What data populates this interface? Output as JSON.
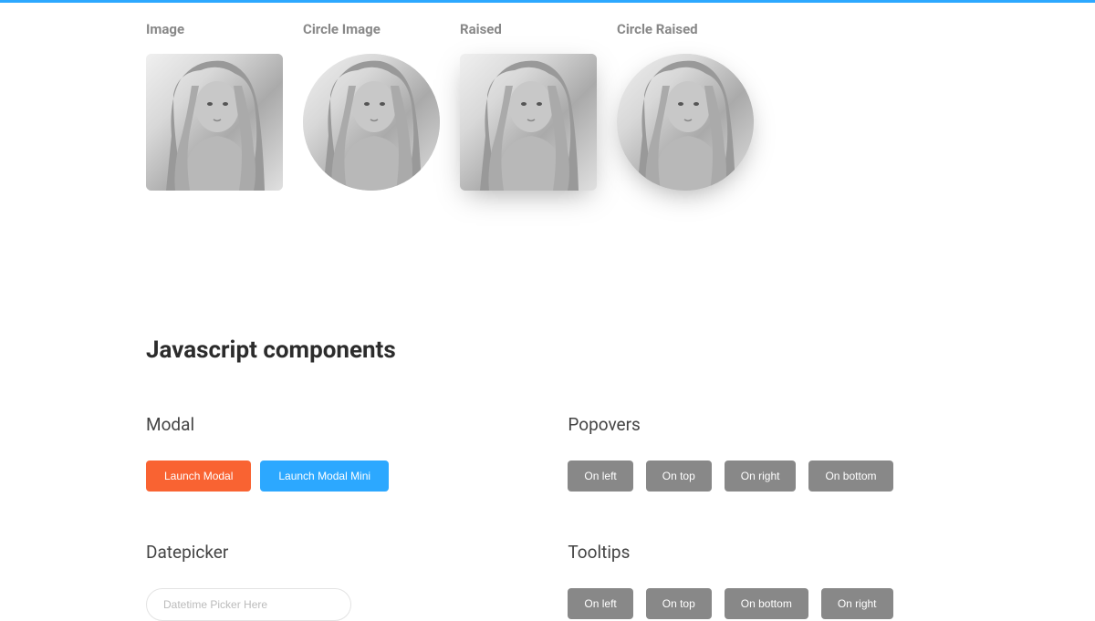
{
  "images": {
    "labels": [
      "Image",
      "Circle Image",
      "Raised",
      "Circle Raised"
    ]
  },
  "section_title": "Javascript components",
  "modal": {
    "title": "Modal",
    "buttons": {
      "launch": "Launch Modal",
      "launch_mini": "Launch Modal Mini"
    }
  },
  "popovers": {
    "title": "Popovers",
    "buttons": [
      "On left",
      "On top",
      "On right",
      "On bottom"
    ]
  },
  "datepicker": {
    "title": "Datepicker",
    "placeholder": "Datetime Picker Here"
  },
  "tooltips": {
    "title": "Tooltips",
    "buttons": [
      "On left",
      "On top",
      "On bottom",
      "On right"
    ]
  }
}
